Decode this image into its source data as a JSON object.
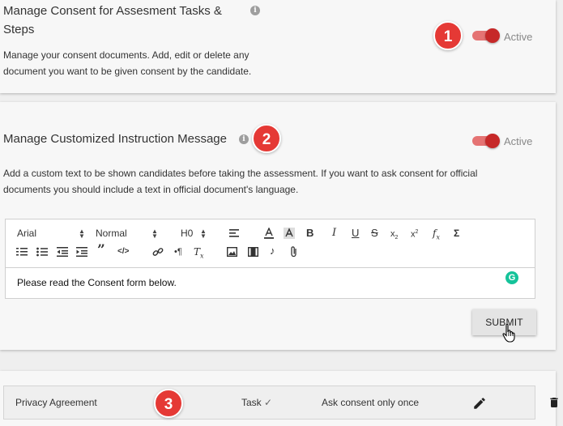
{
  "consent_section": {
    "title_line1": "Manage Consent for Assesment Tasks &",
    "title_line2": "Steps",
    "description_line1": "Manage your consent documents. Add, edit or delete any",
    "description_line2": "document you want to be given consent by the candidate.",
    "toggle_label": "Active",
    "toggle_on": true,
    "badge": "1"
  },
  "instruction_section": {
    "title": "Manage Customized Instruction Message",
    "description_line1": "Add a custom text to be shown candidates before taking the assessment. If you want to ask consent for official",
    "description_line2": "documents you should include a text in official document's language.",
    "toggle_label": "Active",
    "toggle_on": true,
    "badge": "2",
    "editor": {
      "font": "Arial",
      "size": "Normal",
      "heading": "H0",
      "content": "Please read the Consent form below."
    },
    "submit_label": "SUBMIT"
  },
  "consent_list": {
    "badge": "3",
    "rows": [
      {
        "name": "Privacy Agreement",
        "type": "Task",
        "type_check": "✓",
        "frequency": "Ask consent only once"
      }
    ]
  },
  "colors": {
    "accent_red": "#e53935",
    "toggle_knob": "#c62828",
    "toggle_track": "#e57373",
    "grammarly": "#15c39a"
  }
}
